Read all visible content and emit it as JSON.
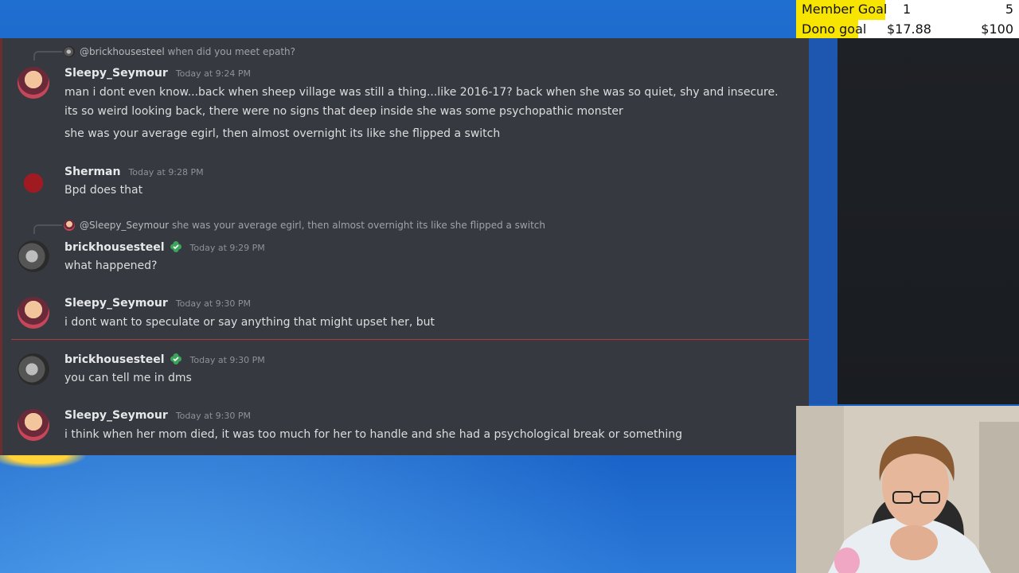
{
  "overlay": {
    "member_goal": {
      "label": "Member Goal",
      "current": "1",
      "target": "5",
      "progress": 0.2
    },
    "dono_goal": {
      "label": "Dono goal",
      "current": "$17.88",
      "target": "$100",
      "progress": 0.1788
    }
  },
  "chat": {
    "messages": [
      {
        "reply_to": {
          "name": "@brickhousesteel",
          "text": "when did you meet epath?"
        },
        "author": "Sleepy_Seymour",
        "timestamp": "Today at 9:24 PM",
        "lines": [
          "man i dont even know...back when sheep village was still a thing...like 2016-17? back when she was so quiet, shy and insecure.",
          "its so weird looking back, there were no signs that deep inside she was some psychopathic monster",
          "she was your average egirl, then almost overnight its like  she flipped a switch"
        ]
      },
      {
        "author": "Sherman",
        "timestamp": "Today at 9:28 PM",
        "lines": [
          "Bpd does that"
        ]
      },
      {
        "reply_to": {
          "name": "@Sleepy_Seymour",
          "text": "she was your average egirl, then almost overnight its like  she flipped a switch"
        },
        "author": "brickhousesteel",
        "timestamp": "Today at 9:29 PM",
        "lines": [
          "what happened?"
        ]
      },
      {
        "author": "Sleepy_Seymour",
        "timestamp": "Today at 9:30 PM",
        "lines": [
          "i dont want to speculate or say anything that might upset her, but"
        ]
      },
      {
        "author": "brickhousesteel",
        "timestamp": "Today at 9:30 PM",
        "lines": [
          "you can tell me in dms"
        ]
      },
      {
        "author": "Sleepy_Seymour",
        "timestamp": "Today at 9:30 PM",
        "lines": [
          "i think when her mom died, it was too much for her to handle and she had a psychological break or something"
        ]
      }
    ]
  },
  "colors": {
    "chat_bg": "#36393f",
    "goal_bar": "#f7e400",
    "badge_green": "#3ba55c",
    "new_divider": "#b03a3a"
  },
  "icons": {
    "verified_badge": "green-clover-badge-icon"
  }
}
